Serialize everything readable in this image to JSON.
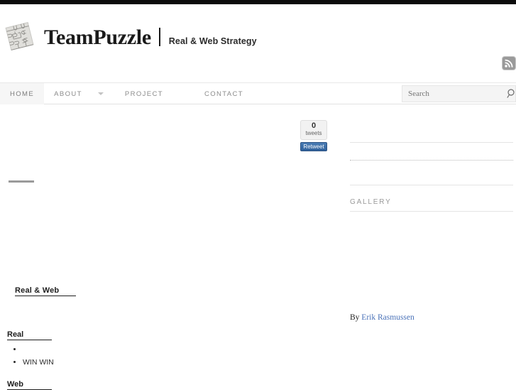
{
  "site": {
    "brand_name": "TeamPuzzle",
    "tagline": "Real & Web Strategy",
    "logo_icon": "puzzle-grid-logo",
    "accent_color": "#4a72b8",
    "top_strip_color": "#0b0b0b"
  },
  "header": {
    "rss_icon": "rss-feed-icon",
    "rss_label": "RSS"
  },
  "nav": {
    "items": [
      {
        "label": "HOME",
        "active": true,
        "has_dropdown": false
      },
      {
        "label": "ABOUT",
        "active": false,
        "has_dropdown": true
      },
      {
        "label": "PROJECT",
        "active": false,
        "has_dropdown": false
      },
      {
        "label": "CONTACT",
        "active": false,
        "has_dropdown": false
      }
    ]
  },
  "search": {
    "placeholder": "Search",
    "value": "",
    "icon": "magnifier-icon"
  },
  "tweet_widget": {
    "count": "0",
    "count_label": "tweets",
    "button_label": "Retweet",
    "button_color": "#3b6ea5"
  },
  "article": {
    "headings": {
      "real_web": "Real & Web",
      "real": "Real",
      "web": "Web"
    },
    "real_bullets": [
      "",
      "WIN WIN"
    ]
  },
  "sidebar": {
    "gallery_title": "GALLERY",
    "byline_prefix": "By",
    "byline_author": "Erik Rasmussen"
  }
}
